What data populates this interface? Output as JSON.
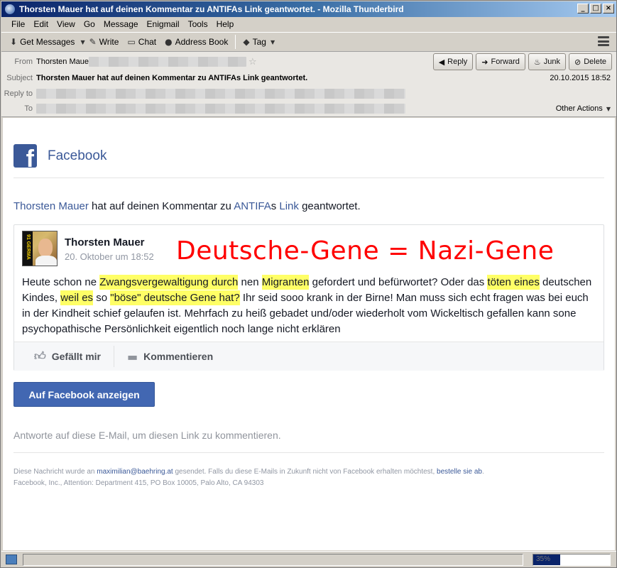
{
  "window": {
    "title": "Thorsten Mauer hat auf deinen Kommentar zu ANTIFAs Link geantwortet. - Mozilla Thunderbird",
    "controls": [
      "_",
      "□",
      "×"
    ]
  },
  "menu": [
    "File",
    "Edit",
    "View",
    "Go",
    "Message",
    "Enigmail",
    "Tools",
    "Help"
  ],
  "toolbar": {
    "get_messages": "Get Messages",
    "write": "Write",
    "chat": "Chat",
    "address_book": "Address Book",
    "tag": "Tag"
  },
  "header": {
    "from_label": "From",
    "from_value": "Thorsten Maue",
    "subject_label": "Subject",
    "subject_value": "Thorsten Mauer hat auf deinen Kommentar zu ANTIFAs Link geantwortet.",
    "reply_to_label": "Reply to",
    "to_label": "To",
    "date": "20.10.2015 18:52",
    "other_actions": "Other Actions",
    "buttons": {
      "reply": "Reply",
      "forward": "Forward",
      "junk": "Junk",
      "delete": "Delete"
    }
  },
  "email": {
    "brand": "Facebook",
    "notification": {
      "author_link": "Thorsten Mauer",
      "text_1": " hat auf deinen Kommentar zu ",
      "page_link": "ANTIFA",
      "text_2": "s ",
      "link_word": "Link",
      "text_3": " geantwortet."
    },
    "post": {
      "author": "Thorsten Mauer",
      "date": "20. Oktober um 18:52",
      "overlay_caption": "Deutsche-Gene = Nazi-Gene",
      "avatar_text": "91 GERMA",
      "body": {
        "p1": "Heute schon ne ",
        "h1": "Zwangsvergewaltigung durch",
        "p2": " nen ",
        "h2": "Migranten",
        "p3": " gefordert und befürwortet? Oder das ",
        "h3": "töten eines",
        "p4": " deutschen Kindes, ",
        "h4": "weil es",
        "p5": " so ",
        "h5": "\"böse\" deutsche Gene hat?",
        "p6": " Ihr seid sooo krank in der Birne! Man muss sich echt fragen was bei euch in der Kindheit schief gelaufen ist. Mehrfach zu heiß gebadet und/oder wiederholt vom Wickeltisch gefallen kann sone psychopathische Persönlichkeit eigentlich noch lange nicht erklären"
      },
      "like_label": "Gefällt mir",
      "comment_label": "Kommentieren"
    },
    "cta_button": "Auf Facebook anzeigen",
    "reply_hint": "Antworte auf diese E-Mail, um diesen Link zu kommentieren.",
    "footer": {
      "p1": "Diese Nachricht wurde an ",
      "email_link": "maximilian@baehring.at",
      "p2": " gesendet. Falls du diese E-Mails in Zukunft nicht von Facebook erhalten möchtest, ",
      "unsub_link": "bestelle sie ab",
      "p3": ".",
      "address": "Facebook, Inc., Attention: Department 415, PO Box 10005, Palo Alto, CA 94303"
    }
  },
  "statusbar": {
    "progress_label": "35%",
    "progress_fraction": 0.35
  },
  "colors": {
    "facebook_blue": "#3b5998",
    "button_blue": "#4267b2",
    "highlight": "#ffff66",
    "overlay_red": "#ff0000"
  }
}
